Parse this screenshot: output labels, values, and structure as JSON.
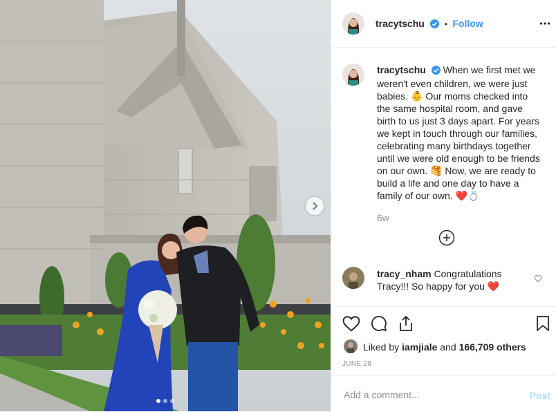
{
  "post": {
    "username": "tracytschu",
    "follow_label": "Follow",
    "separator": "•",
    "caption_text": "When we first met we weren't even children, we were just babies. 👶 Our moms checked into the same hospital room, and gave birth to us just 3 days apart. For years we kept in touch through our families, celebrating many birthdays together until we were old enough to be friends on our own. 🥞 Now, we are ready to build a life and one day to have a family of our own. ❤️💍",
    "time_ago": "6w"
  },
  "comment": {
    "username": "tracy_nham",
    "text": "Congratulations Tracy!!! So happy for you ❤️"
  },
  "likes": {
    "prefix": "Liked by ",
    "user": "iamjiale",
    "middle": " and ",
    "count": "166,709 others"
  },
  "date": "JUNE 28",
  "add_comment": {
    "placeholder": "Add a comment...",
    "post_label": "Post"
  },
  "carousel": {
    "total": 3,
    "active": 1
  },
  "colors": {
    "link": "#3897f0",
    "post_disabled": "#b2dffc",
    "heart": "#ed4956",
    "muted": "#8e8e8e"
  },
  "icons": [
    "more-icon",
    "verified-icon",
    "chevron-right-icon",
    "plus-circle-icon",
    "heart-icon",
    "comment-icon",
    "share-icon",
    "bookmark-icon"
  ]
}
